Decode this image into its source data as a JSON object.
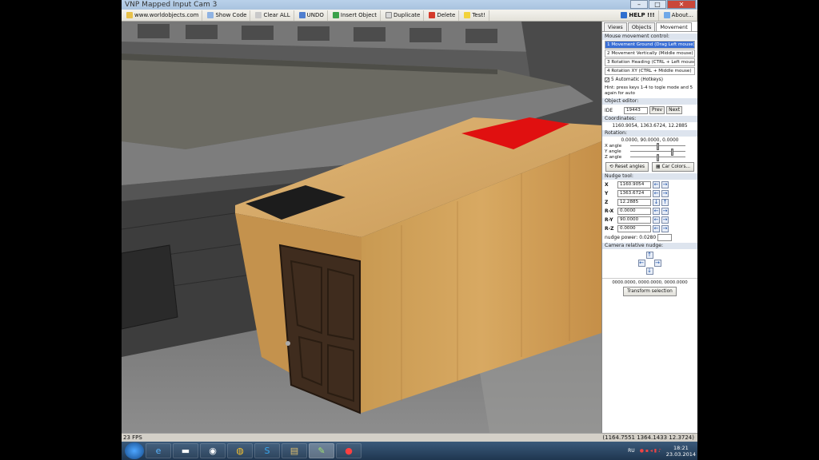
{
  "window": {
    "title": "VNP Mapped Input Cam 3",
    "watermark": "www.worldobjects.com",
    "win_min": "–",
    "win_max": "□",
    "win_close": "✕"
  },
  "toolbar": {
    "show_code": "Show Code",
    "clear_all": "Clear ALL",
    "undo": "UNDO",
    "insert_object": "Insert Object",
    "duplicate": "Duplicate",
    "delete": "Delete",
    "test": "Test!",
    "help": "HELP !!!",
    "about": "About..."
  },
  "panel": {
    "tabs": [
      "Views",
      "Objects",
      "Movement"
    ],
    "mouse_section": "Mouse movement control:",
    "modes": [
      "1 Movement Ground (Drag Left mouse)",
      "2 Movement Vertically (Middle mouse)",
      "3 Rotation Heading (CTRL + Left mouse)",
      "4 Rotation XY (CTRL + Middle mouse)"
    ],
    "auto_label": "5 Automatic (Hotkeys)",
    "hint": "Hint: press keys 1-4 to togle mode and 5 again for auto",
    "object_editor": "Object editor:",
    "ide_label": "IDE",
    "ide_value": "19443",
    "prev": "Prev",
    "next": "Next",
    "coords_label": "Coordinates:",
    "coords_value": "1160.9054, 1363.6724, 12.2885",
    "rotation_label": "Rotation:",
    "rotation_value": "0.0000, 90.0000, 0.0000",
    "x_angle": "X angle",
    "y_angle": "Y angle",
    "z_angle": "Z angle",
    "reset_angles": "Reset angles",
    "car_colors": "Car Colors...",
    "nudge_tool": "Nudge tool:",
    "nudge": [
      {
        "label": "X",
        "value": "1160.9054"
      },
      {
        "label": "Y",
        "value": "1363.6724"
      },
      {
        "label": "Z",
        "value": "12.2885"
      },
      {
        "label": "R-X",
        "value": "0.0000"
      },
      {
        "label": "R-Y",
        "value": "90.0000"
      },
      {
        "label": "R-Z",
        "value": "0.0000"
      }
    ],
    "nudge_power_label": "nudge power: 0.0280",
    "camera_nudge": "Camera relative nudge:",
    "camera_coords": "0000.0000, 0000.0000, 0000.0000",
    "transform": "Transform selection"
  },
  "status": {
    "fps": "23 FPS",
    "cursor_coords": "(1164.7551 1364.1433 12.3724)"
  },
  "taskbar": {
    "lang": "RU",
    "time": "18:21",
    "date": "23.03.2014"
  }
}
